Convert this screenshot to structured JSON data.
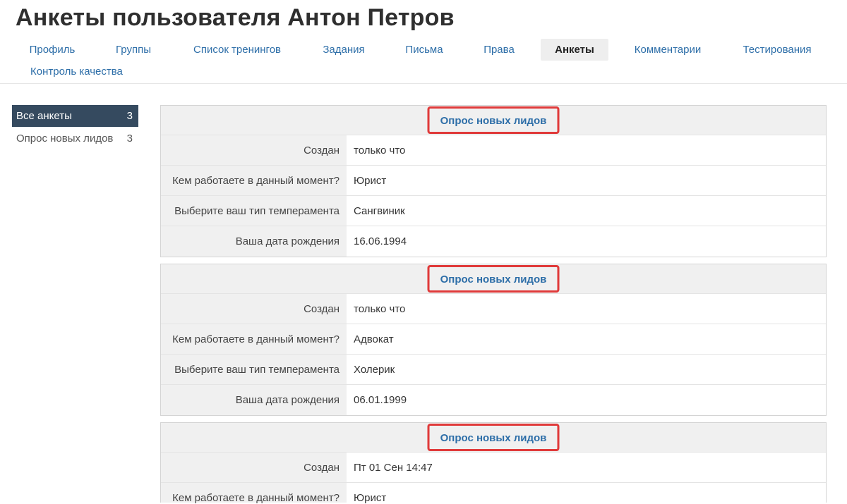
{
  "page_title": "Анкеты пользователя Антон Петров",
  "tabs": [
    {
      "label": "Профиль"
    },
    {
      "label": "Группы"
    },
    {
      "label": "Список тренингов"
    },
    {
      "label": "Задания"
    },
    {
      "label": "Письма"
    },
    {
      "label": "Права"
    },
    {
      "label": "Анкеты",
      "active": true
    },
    {
      "label": "Комментарии"
    },
    {
      "label": "Тестирования"
    },
    {
      "label": "Контроль качества"
    }
  ],
  "sidebar": {
    "items": [
      {
        "label": "Все анкеты",
        "count": "3",
        "active": true
      },
      {
        "label": "Опрос новых лидов",
        "count": "3"
      }
    ]
  },
  "accent_colors": {
    "link": "#2d6ea8",
    "sidebar_active_bg": "#354a5f",
    "highlight_border": "#e03a3a"
  },
  "surveys": [
    {
      "title": "Опрос новых лидов",
      "rows": [
        {
          "label": "Создан",
          "value": "только что"
        },
        {
          "label": "Кем работаете в данный момент?",
          "value": "Юрист"
        },
        {
          "label": "Выберите ваш тип темперамента",
          "value": "Сангвиник"
        },
        {
          "label": "Ваша дата рождения",
          "value": "16.06.1994"
        }
      ]
    },
    {
      "title": "Опрос новых лидов",
      "rows": [
        {
          "label": "Создан",
          "value": "только что"
        },
        {
          "label": "Кем работаете в данный момент?",
          "value": "Адвокат"
        },
        {
          "label": "Выберите ваш тип темперамента",
          "value": "Холерик"
        },
        {
          "label": "Ваша дата рождения",
          "value": "06.01.1999"
        }
      ]
    },
    {
      "title": "Опрос новых лидов",
      "rows": [
        {
          "label": "Создан",
          "value": "Пт 01 Сен 14:47"
        },
        {
          "label": "Кем работаете в данный момент?",
          "value": "Юрист"
        }
      ]
    }
  ]
}
